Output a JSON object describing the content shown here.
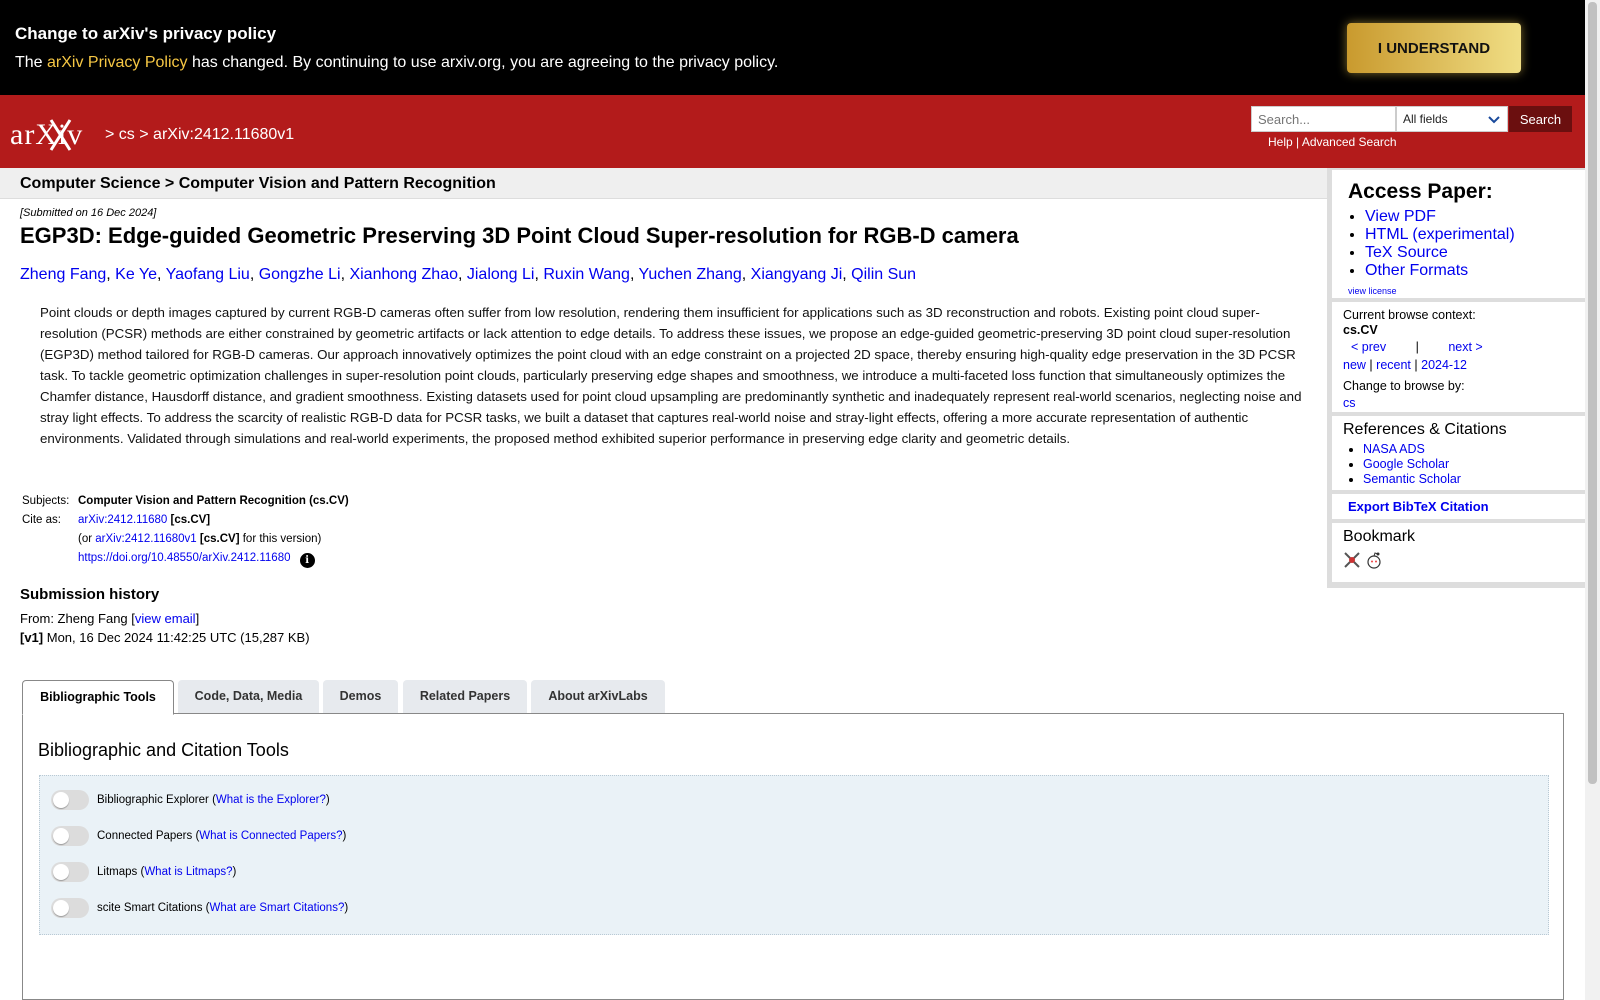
{
  "banner": {
    "title": "Change to arXiv's privacy policy",
    "text_before": "The ",
    "policy_link": "arXiv Privacy Policy",
    "text_after": " has changed. By continuing to use arxiv.org, you are agreeing to the privacy policy.",
    "button_label": "I UNDERSTAND"
  },
  "header": {
    "logo_text": "arXiv",
    "breadcrumb_sep": ">",
    "breadcrumb_cat": "cs",
    "breadcrumb_id": "arXiv:2412.11680v1",
    "search_placeholder": "Search...",
    "field_selected": "All fields",
    "search_button": "Search",
    "help_link": "Help",
    "link_sep": " | ",
    "advanced_link": "Advanced Search"
  },
  "subject_bar": "Computer Science > Computer Vision and Pattern Recognition",
  "paper": {
    "submitted": "[Submitted on 16 Dec 2024]",
    "title": "EGP3D: Edge-guided Geometric Preserving 3D Point Cloud Super-resolution for RGB-D camera",
    "authors": [
      "Zheng Fang",
      "Ke Ye",
      "Yaofang Liu",
      "Gongzhe Li",
      "Xianhong Zhao",
      "Jialong Li",
      "Ruxin Wang",
      "Yuchen Zhang",
      "Xiangyang Ji",
      "Qilin Sun"
    ],
    "abstract": "Point clouds or depth images captured by current RGB-D cameras often suffer from low resolution, rendering them insufficient for applications such as 3D reconstruction and robots. Existing point cloud super-resolution (PCSR) methods are either constrained by geometric artifacts or lack attention to edge details. To address these issues, we propose an edge-guided geometric-preserving 3D point cloud super-resolution (EGP3D) method tailored for RGB-D cameras. Our approach innovatively optimizes the point cloud with an edge constraint on a projected 2D space, thereby ensuring high-quality edge preservation in the 3D PCSR task. To tackle geometric optimization challenges in super-resolution point clouds, particularly preserving edge shapes and smoothness, we introduce a multi-faceted loss function that simultaneously optimizes the Chamfer distance, Hausdorff distance, and gradient smoothness. Existing datasets used for point cloud upsampling are predominantly synthetic and inadequately represent real-world scenarios, neglecting noise and stray light effects. To address the scarcity of realistic RGB-D data for PCSR tasks, we built a dataset that captures real-world noise and stray-light effects, offering a more accurate representation of authentic environments. Validated through simulations and real-world experiments, the proposed method exhibited superior performance in preserving edge clarity and geometric details.",
    "subjects_label": "Subjects:",
    "subjects_value": "Computer Vision and Pattern Recognition (cs.CV)",
    "cite_label": "Cite as:",
    "cite_id": "arXiv:2412.11680",
    "cite_cat": "[cs.CV]",
    "cite2_prefix": "(or ",
    "cite2_id": "arXiv:2412.11680v1",
    "cite2_cat": "[cs.CV]",
    "cite2_suffix": " for this version)",
    "doi": "https://doi.org/10.48550/arXiv.2412.11680",
    "info_icon_glyph": "i"
  },
  "history": {
    "title": "Submission history",
    "from_prefix": "From: Zheng Fang [",
    "from_link": "view email",
    "from_suffix": "]",
    "v1_tag": "[v1]",
    "v1_text": " Mon, 16 Dec 2024 11:42:25 UTC (15,287 KB)"
  },
  "sidebar": {
    "access_title": "Access Paper:",
    "access_links": [
      "View PDF",
      "HTML (experimental)",
      "TeX Source",
      "Other Formats"
    ],
    "view_license": "view license",
    "context_label": "Current browse context:",
    "context_code": "cs.CV",
    "prev": "< prev",
    "nav_sep": "|",
    "next": "next >",
    "new": "new",
    "recent": "recent",
    "month": "2024-12",
    "change_label": "Change to browse by:",
    "change_cat": "cs",
    "refs_title": "References & Citations",
    "refs_links": [
      "NASA ADS",
      "Google Scholar",
      "Semantic Scholar"
    ],
    "export": "Export BibTeX Citation",
    "bookmark_title": "Bookmark"
  },
  "tabs": [
    "Bibliographic Tools",
    "Code, Data, Media",
    "Demos",
    "Related Papers",
    "About arXivLabs"
  ],
  "panel": {
    "title": "Bibliographic and Citation Tools",
    "tools": [
      {
        "label": "Bibliographic Explorer",
        "help": "What is the Explorer?",
        "enabled": false
      },
      {
        "label": "Connected Papers",
        "help": "What is Connected Papers?",
        "enabled": false
      },
      {
        "label": "Litmaps",
        "help": "What is Litmaps?",
        "enabled": false
      },
      {
        "label": "scite Smart Citations",
        "help": "What are Smart Citations?",
        "enabled": false
      }
    ]
  },
  "colors": {
    "header_red": "#b31b1b",
    "banner_black": "#000000",
    "link_blue": "#0000ee",
    "policy_gold": "#f6c744"
  }
}
